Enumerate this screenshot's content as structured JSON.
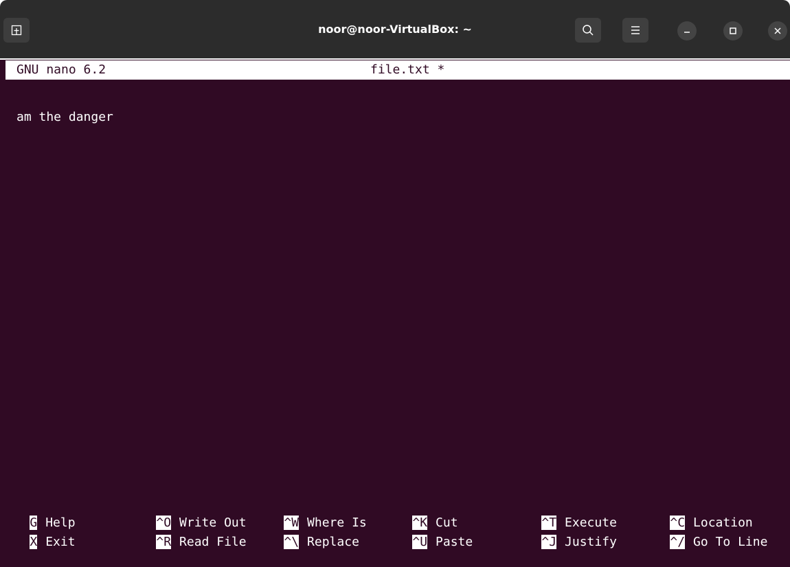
{
  "window": {
    "title": "noor@noor-VirtualBox: ~",
    "icons": {
      "new_tab": "new-tab-icon",
      "search": "search-icon",
      "menu": "hamburger-menu-icon",
      "minimize": "minimize-icon",
      "maximize": "maximize-icon",
      "close": "close-icon"
    }
  },
  "nano": {
    "version": "GNU nano 6.2",
    "filename": "file.txt *",
    "buffer_lines": [
      "am the danger"
    ]
  },
  "shortcuts": [
    {
      "key": "G",
      "label": "Help"
    },
    {
      "key": "^O",
      "label": "Write Out"
    },
    {
      "key": "^W",
      "label": "Where Is"
    },
    {
      "key": "^K",
      "label": "Cut"
    },
    {
      "key": "^T",
      "label": "Execute"
    },
    {
      "key": "^C",
      "label": "Location"
    },
    {
      "key": "X",
      "label": "Exit"
    },
    {
      "key": "^R",
      "label": "Read File"
    },
    {
      "key": "^\\",
      "label": "Replace"
    },
    {
      "key": "^U",
      "label": "Paste"
    },
    {
      "key": "^J",
      "label": "Justify"
    },
    {
      "key": "^/",
      "label": "Go To Line"
    }
  ],
  "colors": {
    "terminal_bg": "#300a24",
    "header_bg": "#2c2c2c",
    "text": "#ffffff"
  }
}
